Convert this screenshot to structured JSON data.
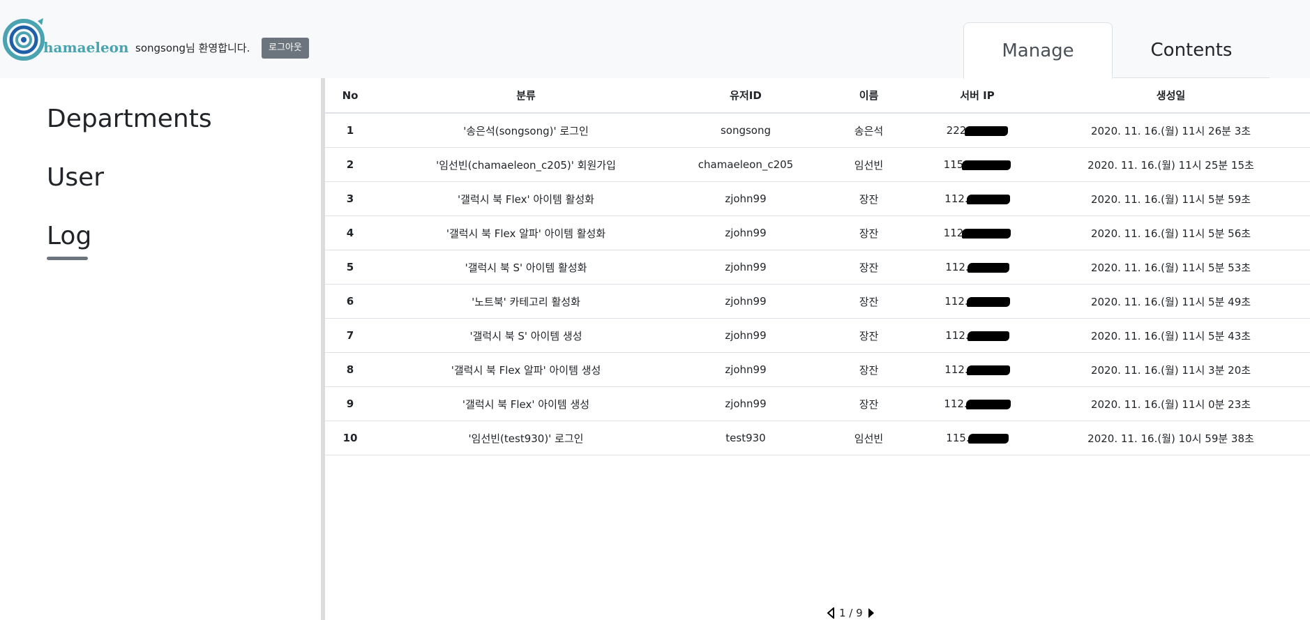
{
  "header": {
    "logo_text": "hamaeleon",
    "welcome": "songsong님 환영합니다.",
    "logout_label": "로그아웃",
    "tabs": [
      {
        "label": "Manage",
        "active": true
      },
      {
        "label": "Contents",
        "active": false
      }
    ]
  },
  "sidebar": {
    "items": [
      {
        "label": "Departments"
      },
      {
        "label": "User"
      },
      {
        "label": "Log",
        "active": true
      }
    ]
  },
  "table": {
    "columns": [
      "No",
      "분류",
      "유저ID",
      "이름",
      "서버 IP",
      "생성일"
    ],
    "rows": [
      {
        "no": "1",
        "category": "'송은석(songsong)' 로그인",
        "user_id": "songsong",
        "name": "송은석",
        "ip": "222",
        "created": "2020. 11. 16.(월) 11시 26분 3초"
      },
      {
        "no": "2",
        "category": "'임선빈(chamaeleon_c205)' 회원가입",
        "user_id": "chamaeleon_c205",
        "name": "임선빈",
        "ip": "115",
        "created": "2020. 11. 16.(월) 11시 25분 15초"
      },
      {
        "no": "3",
        "category": "'갤럭시 북 Flex' 아이템 활성화",
        "user_id": "zjohn99",
        "name": "장잔",
        "ip": "112.",
        "created": "2020. 11. 16.(월) 11시 5분 59초"
      },
      {
        "no": "4",
        "category": "'갤럭시 북 Flex 알파' 아이템 활성화",
        "user_id": "zjohn99",
        "name": "장잔",
        "ip": "112",
        "created": "2020. 11. 16.(월) 11시 5분 56초"
      },
      {
        "no": "5",
        "category": "'갤럭시 북 S' 아이템 활성화",
        "user_id": "zjohn99",
        "name": "장잔",
        "ip": "112.",
        "created": "2020. 11. 16.(월) 11시 5분 53초"
      },
      {
        "no": "6",
        "category": "'노트북' 카테고리 활성화",
        "user_id": "zjohn99",
        "name": "장잔",
        "ip": "112.",
        "created": "2020. 11. 16.(월) 11시 5분 49초"
      },
      {
        "no": "7",
        "category": "'갤럭시 북 S' 아이템 생성",
        "user_id": "zjohn99",
        "name": "장잔",
        "ip": "112.",
        "created": "2020. 11. 16.(월) 11시 5분 43초"
      },
      {
        "no": "8",
        "category": "'갤럭시 북 Flex 알파' 아이템 생성",
        "user_id": "zjohn99",
        "name": "장잔",
        "ip": "112.",
        "created": "2020. 11. 16.(월) 11시 3분 20초"
      },
      {
        "no": "9",
        "category": "'갤럭시 북 Flex' 아이템 생성",
        "user_id": "zjohn99",
        "name": "장잔",
        "ip": "112.",
        "created": "2020. 11. 16.(월) 11시 0분 23초"
      },
      {
        "no": "10",
        "category": "'임선빈(test930)' 로그인",
        "user_id": "test930",
        "name": "임선빈",
        "ip": "115.",
        "created": "2020. 11. 16.(월) 10시 59분 38초"
      }
    ]
  },
  "pagination": {
    "label": "1 / 9"
  },
  "colors": {
    "logo_teal": "#4aa3b0",
    "logo_blue": "#1f5fa8",
    "button_gray": "#6c757d"
  }
}
